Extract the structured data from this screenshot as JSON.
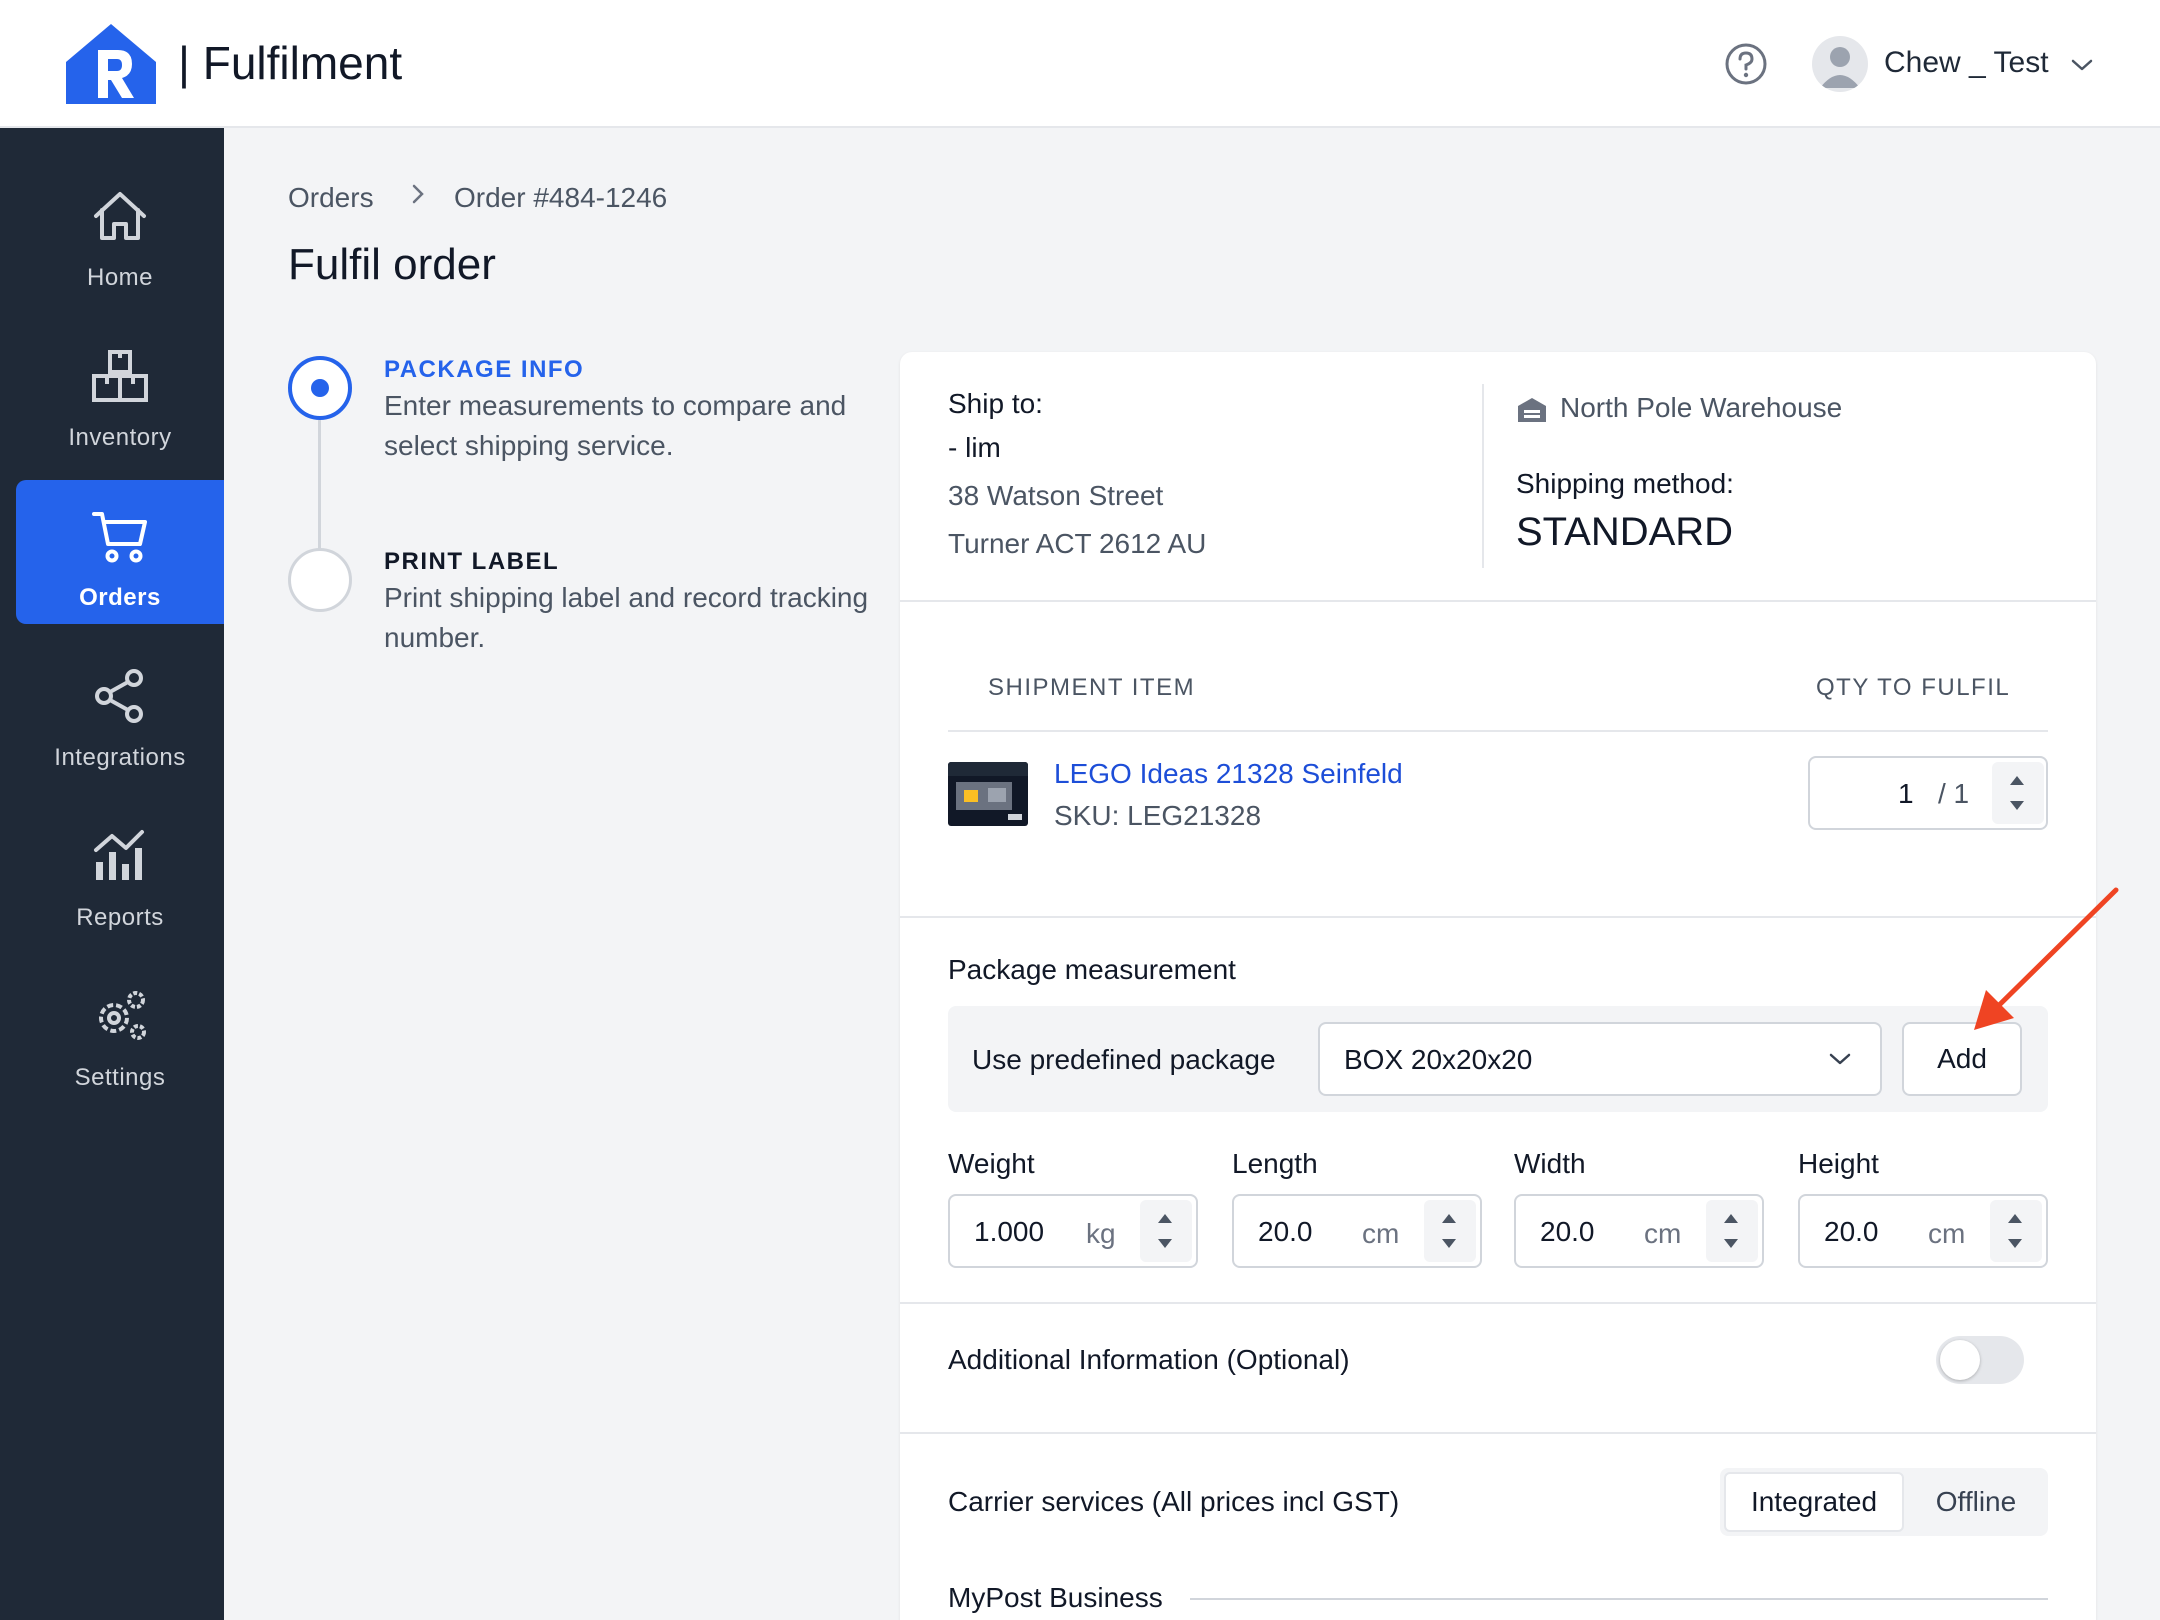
{
  "header": {
    "app_title": "| Fulfilment",
    "user_name": "Chew _ Test",
    "logo_icon": "house-r-logo-icon",
    "brand_color": "#2563eb"
  },
  "sidebar": {
    "items": [
      {
        "label": "Home",
        "icon": "home-icon",
        "active": false
      },
      {
        "label": "Inventory",
        "icon": "boxes-icon",
        "active": false
      },
      {
        "label": "Orders",
        "icon": "cart-icon",
        "active": true
      },
      {
        "label": "Integrations",
        "icon": "share-icon",
        "active": false
      },
      {
        "label": "Reports",
        "icon": "chart-icon",
        "active": false
      },
      {
        "label": "Settings",
        "icon": "gears-icon",
        "active": false
      }
    ],
    "bg_color": "#1f2937"
  },
  "breadcrumb": {
    "root": "Orders",
    "current": "Order #484-1246"
  },
  "page": {
    "title": "Fulfil order"
  },
  "stepper": {
    "steps": [
      {
        "title": "PACKAGE INFO",
        "description": "Enter measurements to compare and select shipping service.",
        "active": true
      },
      {
        "title": "PRINT LABEL",
        "description": "Print shipping label and record tracking number.",
        "active": false
      }
    ]
  },
  "shipping": {
    "ship_to_label": "Ship to:",
    "recipient": "- lim",
    "address_line1": "38 Watson Street",
    "address_line2": "Turner ACT 2612 AU",
    "warehouse": "North Pole Warehouse",
    "method_label": "Shipping method:",
    "method_value": "STANDARD"
  },
  "items_table": {
    "col_item": "SHIPMENT ITEM",
    "col_qty": "QTY TO FULFIL",
    "rows": [
      {
        "name": "LEGO Ideas 21328 Seinfeld",
        "sku": "SKU: LEG21328",
        "qty": "1",
        "qty_total": "/ 1"
      }
    ]
  },
  "package": {
    "section_title": "Package measurement",
    "predefined_label": "Use predefined package",
    "predefined_value": "BOX 20x20x20",
    "add_label": "Add",
    "weight": {
      "label": "Weight",
      "value": "1.000",
      "unit": "kg"
    },
    "length": {
      "label": "Length",
      "value": "20.0",
      "unit": "cm"
    },
    "width": {
      "label": "Width",
      "value": "20.0",
      "unit": "cm"
    },
    "height": {
      "label": "Height",
      "value": "20.0",
      "unit": "cm"
    }
  },
  "additional": {
    "label": "Additional Information (Optional)",
    "enabled": false
  },
  "carrier": {
    "label": "Carrier services (All prices incl GST)",
    "tabs": [
      "Integrated",
      "Offline"
    ],
    "active_tab": "Integrated",
    "group_label": "MyPost Business"
  },
  "annotation": {
    "arrow_color": "#ef4423"
  }
}
